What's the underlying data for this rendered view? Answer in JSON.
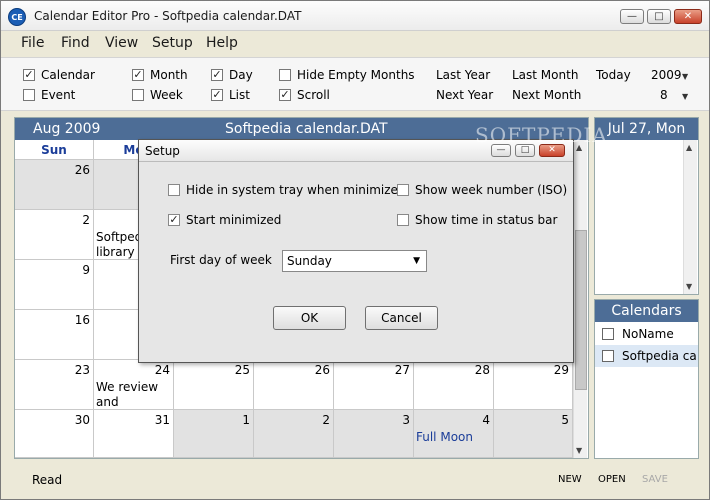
{
  "window": {
    "title": "Calendar Editor Pro - Softpedia calendar.DAT",
    "icon_text": "CE",
    "minimize": "—",
    "maximize": "□",
    "close": "✕"
  },
  "menu": [
    "File",
    "Find",
    "View",
    "Setup",
    "Help"
  ],
  "toolbar": {
    "checks": [
      {
        "label": "Calendar",
        "checked": true
      },
      {
        "label": "Event",
        "checked": false
      },
      {
        "label": "Month",
        "checked": true
      },
      {
        "label": "Week",
        "checked": false
      },
      {
        "label": "Day",
        "checked": true
      },
      {
        "label": "List",
        "checked": true
      },
      {
        "label": "Hide Empty Months",
        "checked": false
      },
      {
        "label": "Scroll",
        "checked": true
      }
    ],
    "nav": [
      "Last Year",
      "Last Month",
      "Next Year",
      "Next Month",
      "Today"
    ],
    "year": "2009",
    "month": "8"
  },
  "calendar": {
    "month_label": "Aug  2009",
    "name": "Softpedia calendar.DAT",
    "dow": [
      "Sun",
      "Mo"
    ],
    "rows": [
      [
        "26",
        "",
        "",
        "",
        "",
        "",
        ""
      ],
      [
        "2",
        "",
        "",
        "",
        "",
        "",
        ""
      ],
      [
        "9",
        "",
        "",
        "",
        "",
        "",
        ""
      ],
      [
        "16",
        "",
        "",
        "",
        "",
        "",
        ""
      ],
      [
        "23",
        "24",
        "25",
        "26",
        "27",
        "28",
        "29"
      ],
      [
        "30",
        "31",
        "1",
        "2",
        "3",
        "4",
        "5"
      ]
    ],
    "events": {
      "r1c1": "Softped\nlibrary c",
      "r4c1": "We review\nand",
      "r5c5": "Full Moon"
    }
  },
  "day_panel": {
    "date": "Jul 27, Mon"
  },
  "calendars": {
    "header": "Calendars",
    "items": [
      "NoName",
      "Softpedia ca"
    ]
  },
  "status": {
    "text": "Read",
    "new": "NEW",
    "open": "OPEN",
    "save": "SAVE"
  },
  "dialog": {
    "title": "Setup",
    "options": [
      {
        "label": "Hide in system tray when minimized",
        "checked": false
      },
      {
        "label": "Start minimized",
        "checked": true
      },
      {
        "label": "Show week number (ISO)",
        "checked": false
      },
      {
        "label": "Show time in status bar",
        "checked": false
      }
    ],
    "first_day_label": "First day of week",
    "first_day_value": "Sunday",
    "ok": "OK",
    "cancel": "Cancel"
  },
  "watermark": "SOFTPEDIA",
  "colors": {
    "header_blue": "#4d6d96",
    "dow_blue": "#1b3d99",
    "gray_cell": "#e2e2e2"
  }
}
